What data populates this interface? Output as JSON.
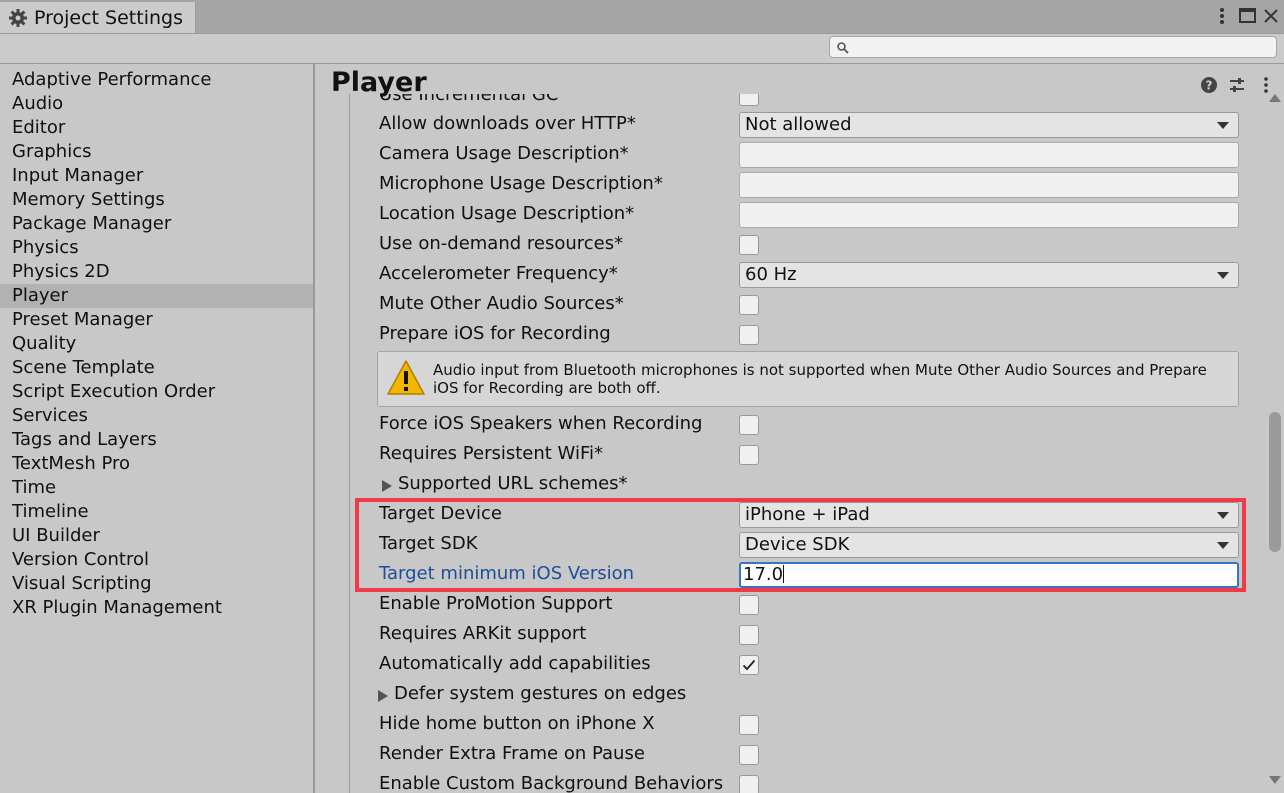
{
  "window": {
    "tab_title": "Project Settings",
    "icons": [
      "gear-icon",
      "more-vertical-icon",
      "maximize-icon",
      "close-icon"
    ]
  },
  "search": {
    "placeholder": "",
    "value": ""
  },
  "sidebar": {
    "selected": "Player",
    "items": [
      {
        "label": "Adaptive Performance"
      },
      {
        "label": "Audio"
      },
      {
        "label": "Editor"
      },
      {
        "label": "Graphics"
      },
      {
        "label": "Input Manager"
      },
      {
        "label": "Memory Settings"
      },
      {
        "label": "Package Manager"
      },
      {
        "label": "Physics"
      },
      {
        "label": "Physics 2D"
      },
      {
        "label": "Player"
      },
      {
        "label": "Preset Manager"
      },
      {
        "label": "Quality"
      },
      {
        "label": "Scene Template"
      },
      {
        "label": "Script Execution Order"
      },
      {
        "label": "Services"
      },
      {
        "label": "Tags and Layers"
      },
      {
        "label": "TextMesh Pro"
      },
      {
        "label": "Time"
      },
      {
        "label": "Timeline"
      },
      {
        "label": "UI Builder"
      },
      {
        "label": "Version Control"
      },
      {
        "label": "Visual Scripting"
      },
      {
        "label": "XR Plugin Management"
      }
    ]
  },
  "main": {
    "title": "Player",
    "header_icons": [
      "help-icon",
      "presets-icon",
      "more-vertical-icon"
    ],
    "cut_row_label": "Use Incremental GC",
    "rows": {
      "allow_http": {
        "label": "Allow downloads over HTTP*",
        "value": "Not allowed"
      },
      "camera_usage": {
        "label": "Camera Usage Description*",
        "value": ""
      },
      "microphone_usage": {
        "label": "Microphone Usage Description*",
        "value": ""
      },
      "location_usage": {
        "label": "Location Usage Description*",
        "value": ""
      },
      "on_demand": {
        "label": "Use on-demand resources*",
        "checked": false
      },
      "accelerometer": {
        "label": "Accelerometer Frequency*",
        "value": "60 Hz"
      },
      "mute_audio": {
        "label": "Mute Other Audio Sources*",
        "checked": false
      },
      "prepare_recording": {
        "label": "Prepare iOS for Recording",
        "checked": false
      },
      "force_speakers": {
        "label": "Force iOS Speakers when Recording",
        "checked": false
      },
      "persistent_wifi": {
        "label": "Requires Persistent WiFi*",
        "checked": false
      },
      "url_schemes": {
        "label": "Supported URL schemes*"
      },
      "target_device": {
        "label": "Target Device",
        "value": "iPhone + iPad"
      },
      "target_sdk": {
        "label": "Target SDK",
        "value": "Device SDK"
      },
      "min_ios": {
        "label": "Target minimum iOS Version",
        "value": "17.0"
      },
      "promotion": {
        "label": "Enable ProMotion Support",
        "checked": false
      },
      "arkit": {
        "label": "Requires ARKit support",
        "checked": false
      },
      "auto_caps": {
        "label": "Automatically add capabilities",
        "checked": true
      },
      "defer_gestures": {
        "label": "Defer system gestures on edges"
      },
      "hide_home": {
        "label": "Hide home button on iPhone X",
        "checked": false
      },
      "extra_frame": {
        "label": "Render Extra Frame on Pause",
        "checked": false
      },
      "custom_bg": {
        "label": "Enable Custom Background Behaviors",
        "checked": false
      }
    },
    "warning": {
      "icon": "warning-icon",
      "text": "Audio input from Bluetooth microphones is not supported when Mute Other Audio Sources and Prepare iOS for Recording are both off."
    }
  },
  "colors": {
    "highlight_border": "#ef3b46",
    "focused_label": "#1c4f9a",
    "focus_ring": "#3a73c4"
  }
}
